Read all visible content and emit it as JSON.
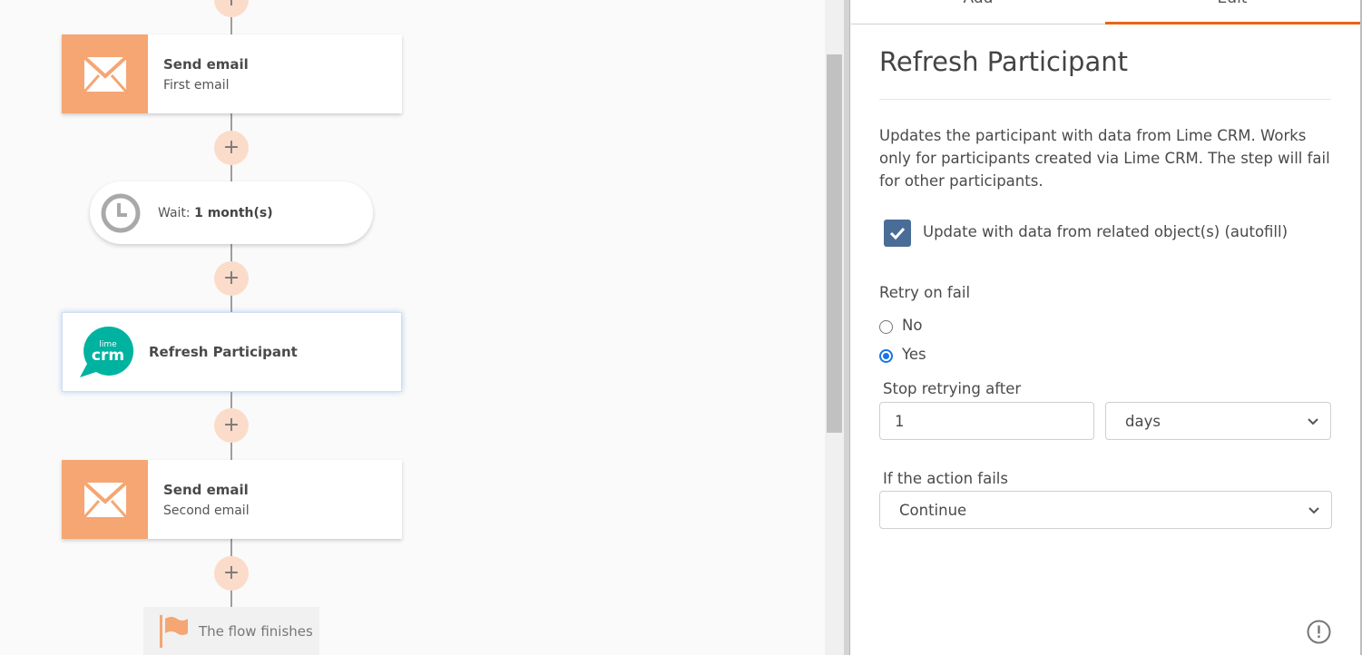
{
  "flow": {
    "nodes": [
      {
        "type": "email",
        "title": "Send email",
        "subtitle": "First email",
        "icon": "envelope-icon"
      },
      {
        "type": "wait",
        "label": "Wait: ",
        "value": "1 month(s)",
        "icon": "clock-icon"
      },
      {
        "type": "crm",
        "title": "Refresh Participant",
        "icon": "lime-crm-logo",
        "logo_small": "lime",
        "logo_big": "crm"
      },
      {
        "type": "email",
        "title": "Send email",
        "subtitle": "Second email",
        "icon": "envelope-icon"
      }
    ],
    "finish": {
      "label": "The flow finishes",
      "icon": "flag-icon"
    },
    "add_step_symbol": "+"
  },
  "panel": {
    "tabs": [
      {
        "label": "Add",
        "active": false
      },
      {
        "label": "Edit",
        "active": true
      }
    ],
    "title": "Refresh Participant",
    "description": "Updates the participant with data from Lime CRM. Works only for participants created via Lime CRM. The step will fail for other participants.",
    "autofill": {
      "label": "Update with data from related object(s) (autofill)",
      "checked": true
    },
    "retry": {
      "label": "Retry on fail",
      "options": [
        {
          "label": "No",
          "selected": false
        },
        {
          "label": "Yes",
          "selected": true
        }
      ]
    },
    "stop_retrying": {
      "label": "Stop retrying after",
      "value": "1",
      "unit": "days"
    },
    "on_fail": {
      "label": "If the action fails",
      "value": "Continue"
    }
  },
  "colors": {
    "accent": "#ea6412",
    "email_icon_bg": "#f5a673",
    "plus_bg": "#fbdcca",
    "lime_teal": "#00b2a0",
    "checkbox": "#4a6d97",
    "radio": "#1a73e8"
  }
}
